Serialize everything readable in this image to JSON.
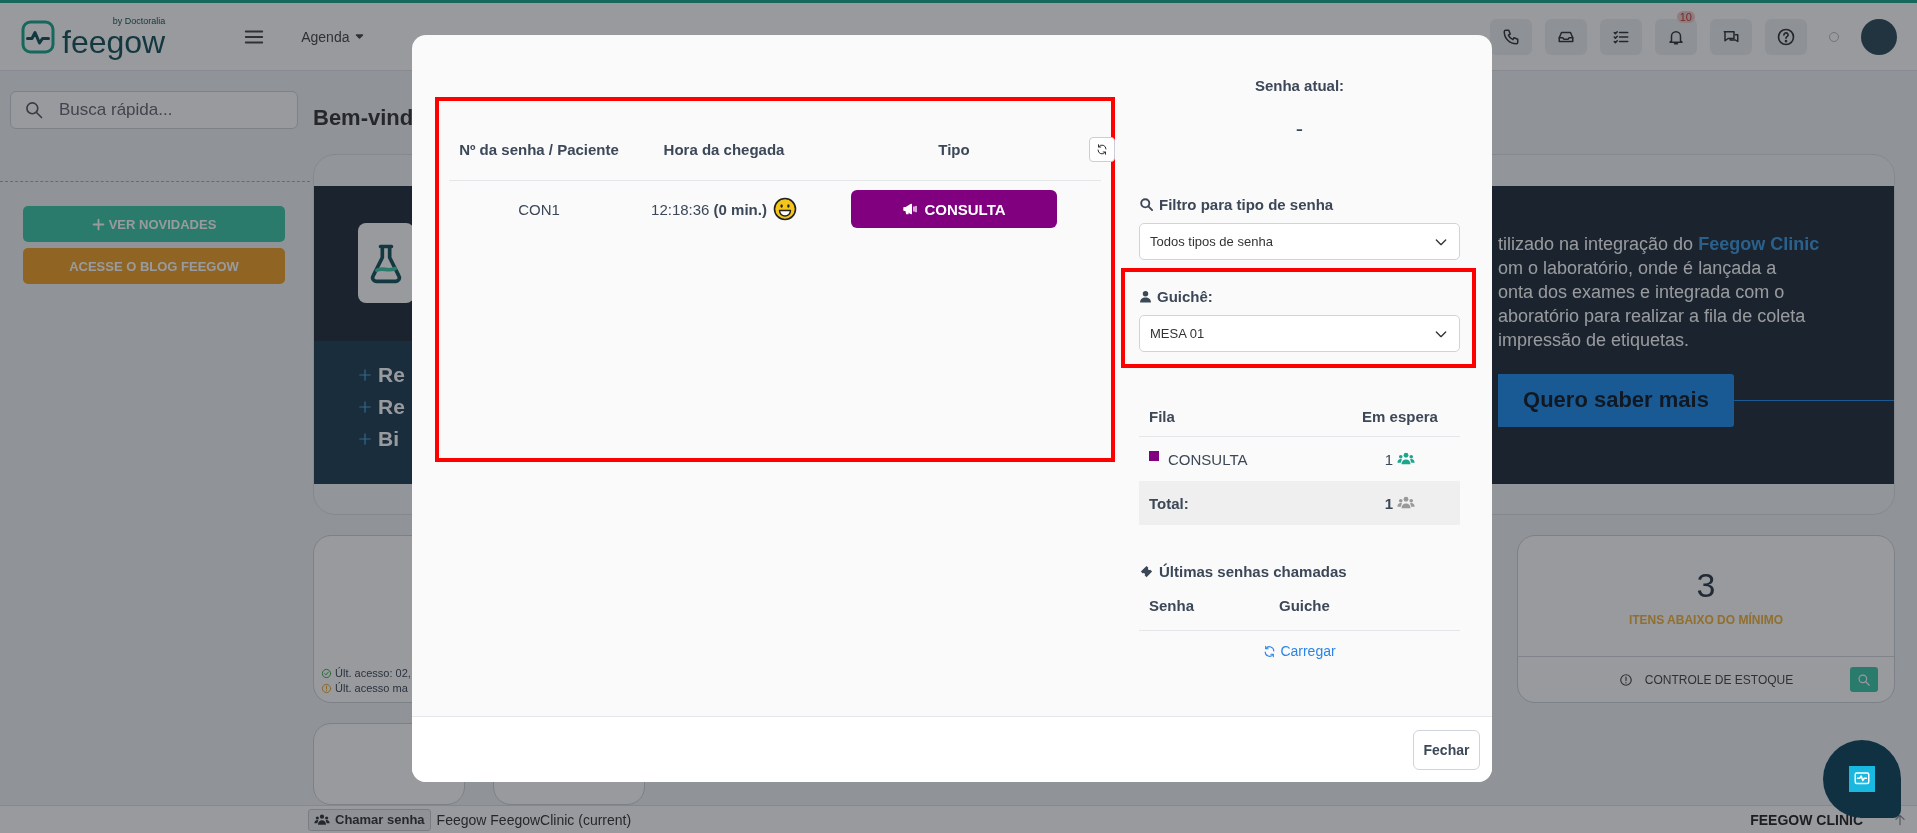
{
  "topbar": {
    "logo": "feegow",
    "logo_tagline": "by Doctoralia",
    "nav": [
      {
        "label": "Agenda"
      }
    ],
    "notifications_badge": "10"
  },
  "sidebar": {
    "search": {
      "placeholder": "Busca rápida..."
    },
    "buttons": [
      {
        "label": "VER NOVIDADES",
        "kind": "news"
      },
      {
        "label": "ACESSE O BLOG FEEGOW",
        "kind": "blog"
      }
    ]
  },
  "main": {
    "greeting": "Bem-vind",
    "banner": {
      "bullets": [
        "Re",
        "Re",
        "Bi"
      ],
      "text_lines": [
        "tilizado na integração do **Feegow Clinic**",
        "om o laboratório, onde é lançada a",
        "onta dos exames e integrada com o",
        "aboratório para realizar a fila de coleta",
        "impressão de etiquetas."
      ],
      "cta": "Quero saber mais"
    },
    "access_card": {
      "lines": [
        {
          "kind": "ok",
          "text": "Últ. acesso: 02,"
        },
        {
          "kind": "warning",
          "text": "Últ. acesso ma"
        }
      ]
    },
    "stock_card": {
      "value": "3",
      "label": "ITENS ABAIXO DO MÍNIMO",
      "footer": "CONTROLE DE ESTOQUE"
    }
  },
  "modal": {
    "queue_table": {
      "columns": [
        "Nº da senha / Paciente",
        "Hora da chegada",
        "Tipo"
      ],
      "rows": [
        {
          "ticket": "CON1",
          "arrival_time": "12:18:36",
          "wait": "(0 min.)",
          "type": "CONSULTA",
          "color": "#800080"
        }
      ]
    },
    "current_ticket": {
      "label": "Senha atual:",
      "value": "-"
    },
    "filter": {
      "label": "Filtro para tipo de senha",
      "value": "Todos tipos de senha"
    },
    "counter": {
      "label": "Guichê:",
      "value": "MESA 01"
    },
    "queues": {
      "columns": [
        "Fila",
        "Em espera"
      ],
      "rows": [
        {
          "name": "CONSULTA",
          "color": "#800080",
          "waiting": "1"
        }
      ],
      "total": {
        "label": "Total:",
        "waiting": "1"
      }
    },
    "recent": {
      "title": "Últimas senhas chamadas",
      "columns": [
        "Senha",
        "Guiche"
      ],
      "load_link": "Carregar"
    },
    "close_button": "Fechar"
  },
  "bottombar": {
    "call_button": "Chamar senha",
    "environment": "Feegow FeegowClinic (current)",
    "brand": "FEEGOW CLINIC"
  }
}
